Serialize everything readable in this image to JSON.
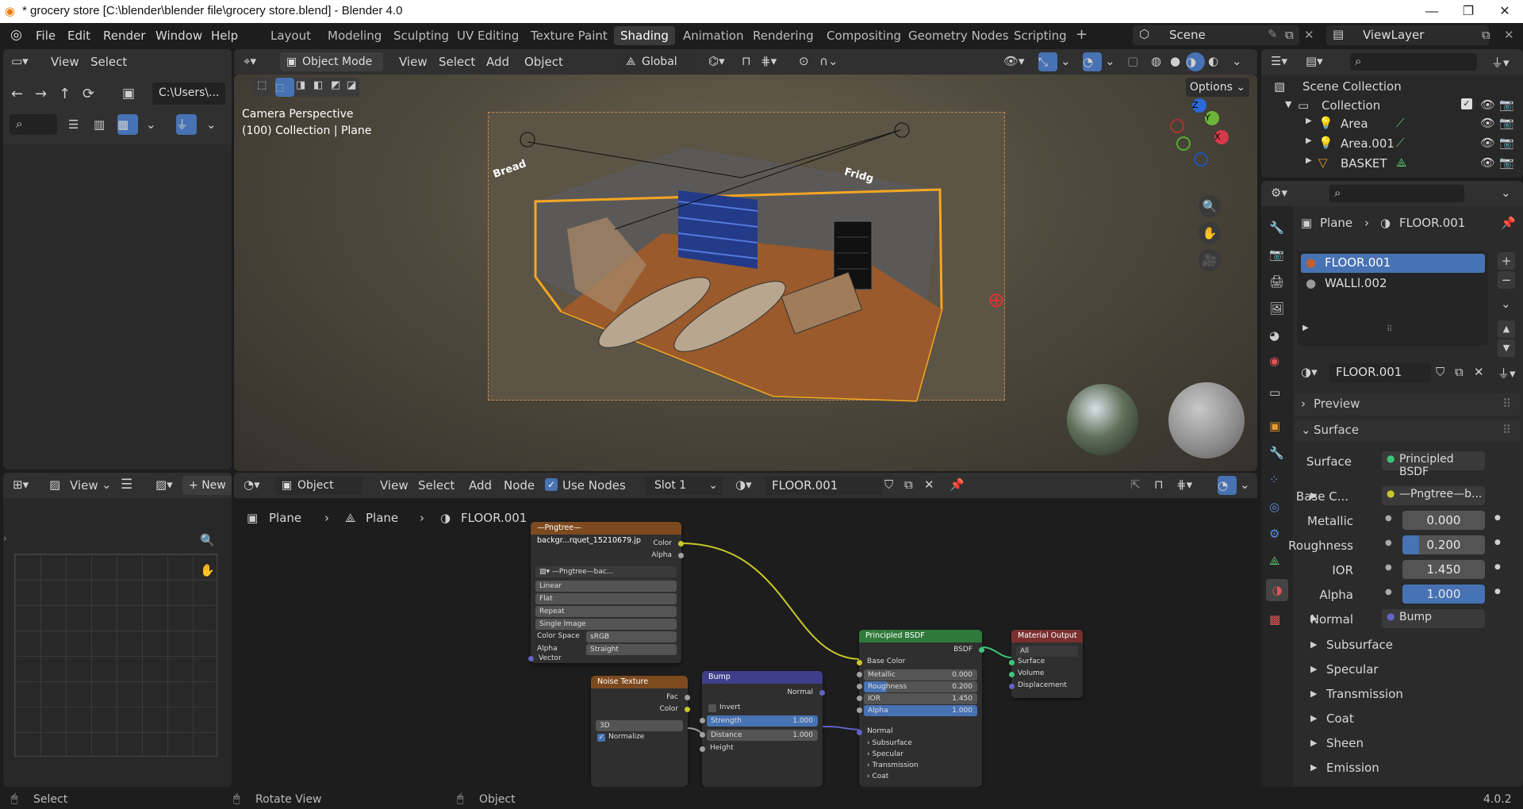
{
  "window": {
    "title": "* grocery store [C:\\blender\\blender file\\grocery store.blend] - Blender 4.0",
    "min": "—",
    "max": "❐",
    "close": "✕"
  },
  "menu": {
    "file": "File",
    "edit": "Edit",
    "render": "Render",
    "window": "Window",
    "help": "Help"
  },
  "workspaces": [
    "Layout",
    "Modeling",
    "Sculpting",
    "UV Editing",
    "Texture Paint",
    "Shading",
    "Animation",
    "Rendering",
    "Compositing",
    "Geometry Nodes",
    "Scripting"
  ],
  "active_workspace": "Shading",
  "scene": {
    "label": "Scene",
    "view_layer": "ViewLayer"
  },
  "filebrowser": {
    "view": "View",
    "select": "Select",
    "path": "C:\\Users\\..."
  },
  "viewport": {
    "mode": "Object Mode",
    "view": "View",
    "select": "Select",
    "add": "Add",
    "object": "Object",
    "transform": "Global",
    "options": "Options",
    "camera_label": "Camera Perspective",
    "collection_label": "(100) Collection | Plane",
    "sign_bread": "Bread",
    "sign_fridge": "Fridg"
  },
  "image_editor": {
    "view": "View",
    "new": "New"
  },
  "node_editor": {
    "type": "Object",
    "view": "View",
    "select": "Select",
    "add": "Add",
    "node": "Node",
    "use_nodes": "Use Nodes",
    "slot": "Slot 1",
    "material": "FLOOR.001",
    "breadcrumb": [
      "Plane",
      "Plane",
      "FLOOR.001"
    ]
  },
  "nodes": {
    "image": {
      "title": "—Pngtree—backgr...rquet_15210679.jp",
      "out_color": "Color",
      "out_alpha": "Alpha",
      "img_name": "—Pngtree—bac...",
      "interp": "Linear",
      "proj": "Flat",
      "ext": "Repeat",
      "source": "Single Image",
      "cs_label": "Color Space",
      "cs_val": "sRGB",
      "alpha_label": "Alpha",
      "alpha_val": "Straight",
      "vector": "Vector"
    },
    "noise": {
      "title": "Noise Texture",
      "fac": "Fac",
      "color": "Color",
      "dim": "3D",
      "normalize": "Normalize"
    },
    "bump": {
      "title": "Bump",
      "normal_out": "Normal",
      "invert": "Invert",
      "strength": "Strength",
      "strength_val": "1.000",
      "distance": "Distance",
      "distance_val": "1.000",
      "height": "Height"
    },
    "bsdf": {
      "title": "Principled BSDF",
      "out": "BSDF",
      "base_color": "Base Color",
      "metallic": "Metallic",
      "metallic_val": "0.000",
      "roughness": "Roughness",
      "roughness_val": "0.200",
      "ior": "IOR",
      "ior_val": "1.450",
      "alpha": "Alpha",
      "alpha_val": "1.000",
      "normal": "Normal",
      "subsurface": "Subsurface",
      "specular": "Specular",
      "transmission": "Transmission",
      "coat": "Coat"
    },
    "output": {
      "title": "Material Output",
      "target": "All",
      "surface": "Surface",
      "volume": "Volume",
      "displacement": "Displacement"
    }
  },
  "outliner": {
    "scene_collection": "Scene Collection",
    "collection": "Collection",
    "items": [
      "Area",
      "Area.001",
      "BASKET"
    ]
  },
  "properties": {
    "breadcrumb_obj": "Plane",
    "breadcrumb_mat": "FLOOR.001",
    "slots": [
      "FLOOR.001",
      "WALLl.002"
    ],
    "material_name": "FLOOR.001",
    "preview": "Preview",
    "surface_section": "Surface",
    "surface_label": "Surface",
    "surface_val": "Principled BSDF",
    "base_color_label": "Base C...",
    "base_color_val": "—Pngtree—b...",
    "metallic_label": "Metallic",
    "metallic_val": "0.000",
    "roughness_label": "Roughness",
    "roughness_val": "0.200",
    "roughness_fill": 0.2,
    "ior_label": "IOR",
    "ior_val": "1.450",
    "alpha_label": "Alpha",
    "alpha_val": "1.000",
    "alpha_fill": 1.0,
    "normal_label": "Normal",
    "normal_val": "Bump",
    "sections": [
      "Subsurface",
      "Specular",
      "Transmission",
      "Coat",
      "Sheen",
      "Emission"
    ]
  },
  "status": {
    "select": "Select",
    "rotate": "Rotate View",
    "object": "Object",
    "version": "4.0.2"
  },
  "colors": {
    "accent": "#4772b3",
    "selection_orange": "#f5a623",
    "image_node": "#7d4a1f",
    "shader_node": "#2f7a3a",
    "output_node": "#7a2f2f",
    "vector_node": "#3e3e8a"
  }
}
